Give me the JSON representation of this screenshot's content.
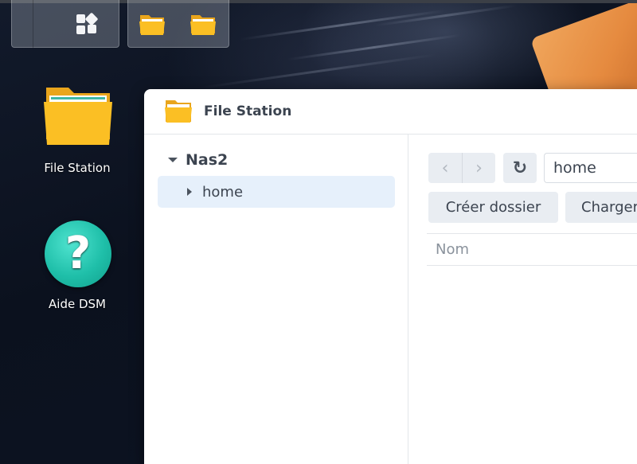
{
  "desktop": {
    "icons": [
      {
        "label": "File Station",
        "icon": "folder-icon"
      },
      {
        "label": "Aide DSM",
        "icon": "help-icon"
      }
    ]
  },
  "taskbar": {
    "main_menu_icon": "grid-icon",
    "open_apps": [
      "folder-icon",
      "folder-icon"
    ]
  },
  "window": {
    "title": "File Station",
    "icon": "folder-icon",
    "tree": {
      "root": "Nas2",
      "items": [
        {
          "label": "home",
          "selected": true
        }
      ]
    },
    "toolbar": {
      "back_symbol": "‹",
      "forward_symbol": "›",
      "refresh_symbol": "↻",
      "path_value": "home",
      "create_folder_label": "Créer dossier",
      "upload_label": "Charger"
    },
    "list": {
      "columns": [
        "Nom"
      ]
    }
  },
  "colors": {
    "folder_yellow": "#fbbf24",
    "help_teal": "#1fbfa9",
    "selected_bg": "#e6f0fb"
  }
}
